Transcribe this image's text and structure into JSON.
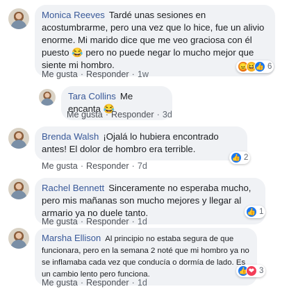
{
  "comments": [
    {
      "author": "Monica Reeves",
      "text": "Tardé unas sesiones en acostumbrarme, pero una vez que lo hice, fue un alivio enorme. Mi marido dice que me veo graciosa con él puesto 😂 pero no puede negar lo mucho mejor que siente mi hombro.",
      "like": "Me gusta",
      "reply": "Responder",
      "time": "1w",
      "reactions": [
        "angry-icon",
        "haha-icon",
        "like-icon"
      ],
      "reaction_count": "6"
    },
    {
      "author": "Tara Collins",
      "text": "Me encanta 😂",
      "like": "Me gusta",
      "reply": "Responder",
      "time": "3d"
    },
    {
      "author": "Brenda Walsh",
      "text": "¡Ojalá lo hubiera encontrado antes! El dolor de hombro era terrible.",
      "like": "Me gusta",
      "reply": "Responder",
      "time": "7d",
      "reactions": [
        "like-icon"
      ],
      "reaction_count": "2"
    },
    {
      "author": "Rachel Bennett",
      "text": "Sinceramente no esperaba mucho, pero mis mañanas son mucho mejores y llegar al armario ya no duele tanto.",
      "like": "Me gusta",
      "reply": "Responder",
      "time": "1d",
      "reactions": [
        "like-icon"
      ],
      "reaction_count": "1"
    },
    {
      "author": "Marsha Ellison",
      "text": "Al principio no estaba segura de que funcionara, pero en la semana 2 noté que mi hombro ya no se inflamaba cada vez que conducía o dormía de lado. Es un cambio lento pero funciona.",
      "like": "Me gusta",
      "reply": "Responder",
      "time": "1d",
      "reactions": [
        "like-icon",
        "love-icon"
      ],
      "reaction_count": "3"
    }
  ],
  "colors": {
    "author": "#385898",
    "bubble": "#f0f2f5",
    "like": "#1877f2",
    "love": "#f33e58"
  }
}
